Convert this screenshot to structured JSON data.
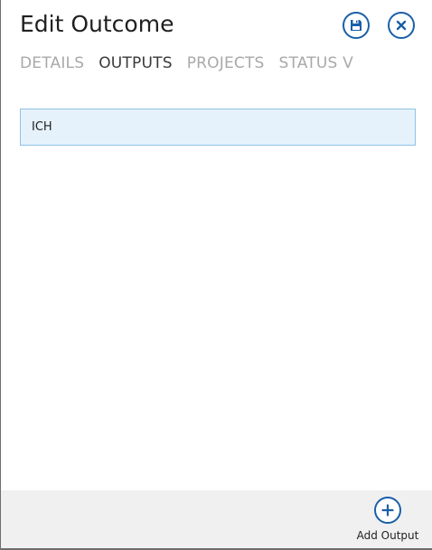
{
  "header": {
    "title": "Edit Outcome",
    "save_icon": "floppy-disk-icon",
    "close_icon": "x-icon"
  },
  "tabs": [
    {
      "label": "DETAILS",
      "active": false
    },
    {
      "label": "OUTPUTS",
      "active": true
    },
    {
      "label": "PROJECTS",
      "active": false
    },
    {
      "label": "STATUS V",
      "active": false
    }
  ],
  "outputs": {
    "items": [
      {
        "label": "ICH",
        "selected": true
      }
    ]
  },
  "footer": {
    "add_output_label": "Add Output",
    "add_output_icon": "plus-icon"
  },
  "colors": {
    "accent": "#1a5fa8",
    "selected_bg": "#e5f2fb",
    "selected_border": "#8fc2e6",
    "tab_inactive": "#a9a9a9",
    "tab_active": "#3a3a3a",
    "footer_bg": "#f0f0f0"
  }
}
